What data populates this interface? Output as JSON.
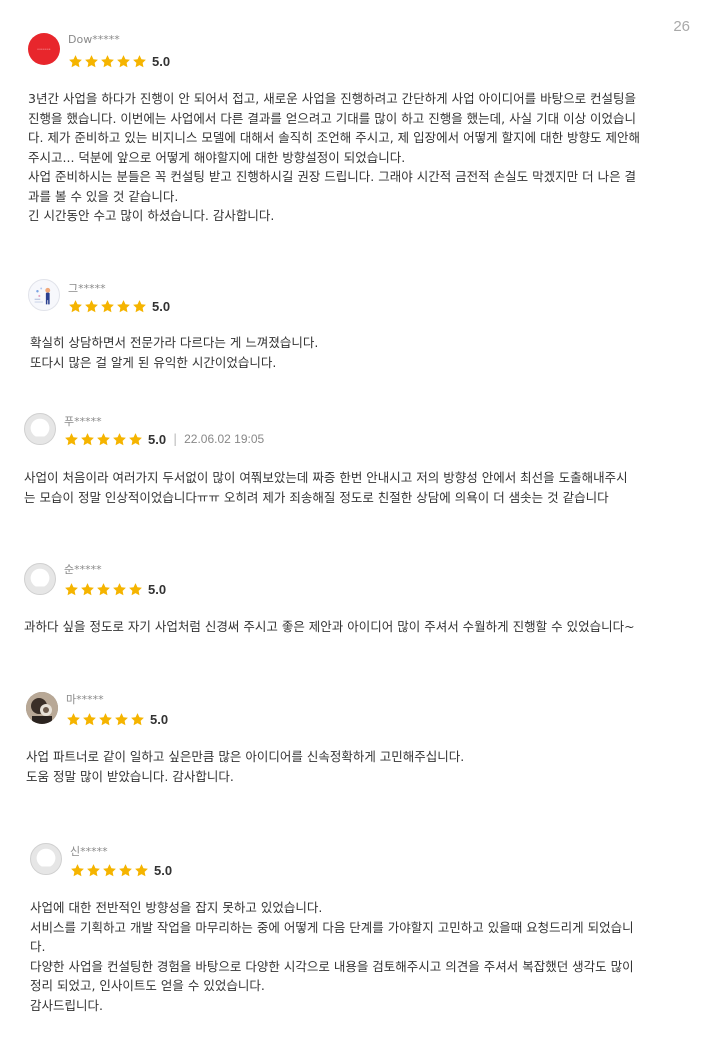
{
  "page_number": "26",
  "colors": {
    "star": "#f5b400",
    "red_avatar": "#e8262c",
    "text": "#333333",
    "muted": "#8a8a8a"
  },
  "reviews": [
    {
      "username": "Dow*****",
      "avatar": "red-logo-avatar",
      "rating_value": 5,
      "score": "5.0",
      "lines": [
        "3년간 사업을 하다가 진행이 안 되어서 접고, 새로운 사업을 진행하려고 간단하게 사업 아이디어를 바탕으로 컨설팅을",
        "진행을 했습니다. 이번에는 사업에서 다른 결과를 얻으려고 기대를 많이 하고 진행을 했는데, 사실 기대 이상 이었습니",
        "다. 제가 준비하고 있는 비지니스 모델에 대해서 솔직히 조언해 주시고, 제 입장에서 어떻게 할지에 대한 방향도 제안해",
        "주시고... 덕분에 앞으로 어떻게 해야할지에 대한 방향설정이 되었습니다.",
        "사업 준비하시는 분들은 꼭 컨설팅 받고 진행하시길 권장 드립니다. 그래야 시간적 금전적 손실도 막겠지만 더 나은 결",
        "과를 볼 수 있을 것 같습니다.",
        "긴 시간동안 수고 많이 하셨습니다. 감사합니다."
      ]
    },
    {
      "username": "그*****",
      "avatar": "illustration-avatar",
      "rating_value": 5,
      "score": "5.0",
      "lines": [
        "확실히 상담하면서 전문가라 다르다는 게 느껴졌습니다.",
        "또다시 많은 걸 알게 된 유익한 시간이었습니다."
      ]
    },
    {
      "username": "푸*****",
      "avatar": "default-user-avatar",
      "rating_value": 5,
      "score": "5.0",
      "separator": "|",
      "date": "22.06.02 19:05",
      "lines": [
        "사업이 처음이라 여러가지 두서없이 많이 여쭤보았는데 짜증 한번 안내시고 저의 방향성 안에서 최선을 도출해내주시",
        "는 모습이 정말 인상적이었습니다ㅠㅠ 오히려 제가 죄송해질 정도로 친절한 상담에 의욕이 더 샘솟는 것 같습니다"
      ]
    },
    {
      "username": "순*****",
      "avatar": "default-user-avatar",
      "rating_value": 5,
      "score": "5.0",
      "lines": [
        "과하다 싶을 정도로 자기 사업처럼 신경써 주시고 좋은 제안과 아이디어 많이 주셔서 수월하게 진행할 수 있었습니다~"
      ]
    },
    {
      "username": "마*****",
      "avatar": "photo-avatar",
      "rating_value": 5,
      "score": "5.0",
      "lines": [
        "사업 파트너로 같이 일하고 싶은만큼 많은 아이디어를 신속정확하게 고민해주십니다.",
        "도움 정말 많이 받았습니다. 감사합니다."
      ]
    },
    {
      "username": "신*****",
      "avatar": "default-user-avatar",
      "rating_value": 5,
      "score": "5.0",
      "lines": [
        "사업에 대한 전반적인 방향성을 잡지 못하고 있었습니다.",
        "서비스를 기획하고 개발 작업을 마무리하는 중에 어떻게 다음 단계를 가야할지 고민하고 있을때 요청드리게 되었습니",
        "다.",
        "다양한 사업을 컨설팅한 경험을 바탕으로 다양한 시각으로 내용을 검토해주시고 의견을 주셔서 복잡했던 생각도 많이",
        "정리 되었고, 인사이트도 얻을 수 있었습니다.",
        "감사드립니다."
      ]
    }
  ]
}
